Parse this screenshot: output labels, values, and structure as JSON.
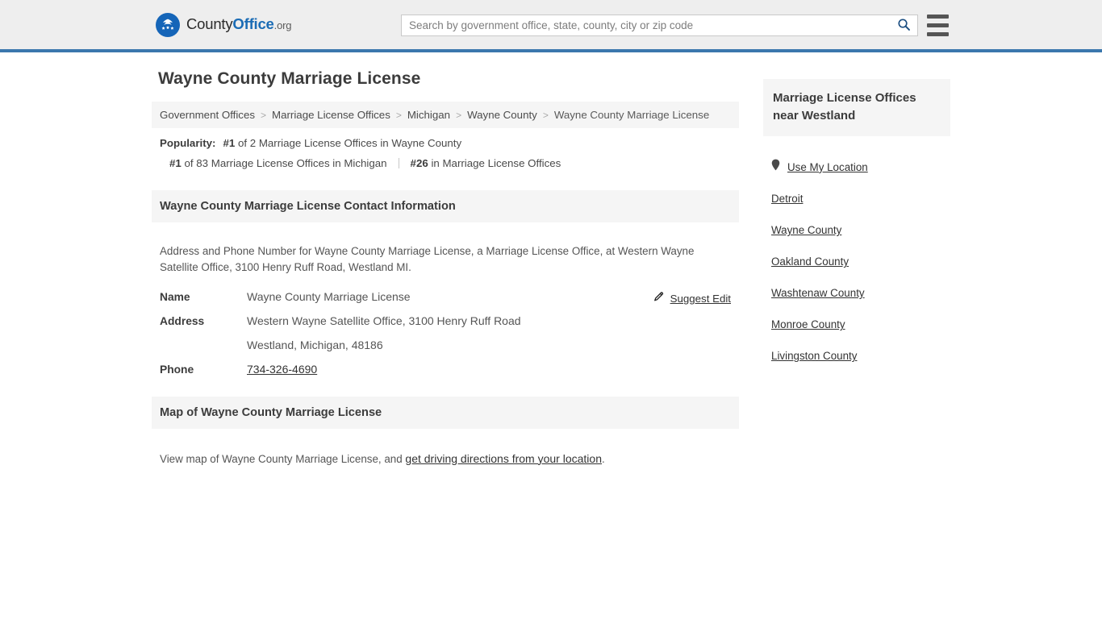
{
  "header": {
    "brand": {
      "logo_icon": "countyoffice-eagle-logo",
      "name_part1": "County",
      "name_part2": "Office",
      "name_part3": ".org"
    },
    "search": {
      "placeholder": "Search by government office, state, county, city or zip code",
      "value": "",
      "icon": "search-icon"
    },
    "menu": {
      "icon": "hamburger-menu-icon",
      "label": "Menu"
    },
    "accent_color": "#3b77ad",
    "background_color": "#eeeeee"
  },
  "page": {
    "title": "Wayne County Marriage License"
  },
  "breadcrumb": {
    "separator": ">",
    "items": [
      {
        "label": "Government Offices",
        "current": false
      },
      {
        "label": "Marriage License Offices",
        "current": false
      },
      {
        "label": "Michigan",
        "current": false
      },
      {
        "label": "Wayne County",
        "current": false
      },
      {
        "label": "Wayne County Marriage License",
        "current": true
      }
    ]
  },
  "popularity": {
    "label": "Popularity:",
    "primary_rank": "#1",
    "primary_text": "of 2 Marriage License Offices in Wayne County",
    "secondary_rank": "#1",
    "secondary_text": "of 83 Marriage License Offices in Michigan",
    "tertiary_rank": "#26",
    "tertiary_text": "in Marriage License Offices"
  },
  "contact_section": {
    "heading": "Wayne County Marriage License Contact Information",
    "description": "Address and Phone Number for Wayne County Marriage License, a Marriage License Office, at Western Wayne Satellite Office, 3100 Henry Ruff Road, Westland MI.",
    "suggest_edit": {
      "label": "Suggest Edit",
      "icon": "edit-pencil-icon"
    },
    "rows": {
      "name_label": "Name",
      "name_value": "Wayne County Marriage License",
      "address_label": "Address",
      "address_line1": "Western Wayne Satellite Office, 3100 Henry Ruff Road",
      "address_line2": "Westland, Michigan, 48186",
      "phone_label": "Phone",
      "phone_value": "734-326-4690"
    }
  },
  "map_section": {
    "heading": "Map of Wayne County Marriage License",
    "text_before": "View map of Wayne County Marriage License, and ",
    "link_label": "get driving directions from your location",
    "text_after": "."
  },
  "sidebar": {
    "heading": "Marriage License Offices near Westland",
    "use_my_location": {
      "label": "Use My Location",
      "icon": "map-pin-icon"
    },
    "links": [
      {
        "label": "Detroit"
      },
      {
        "label": "Wayne County"
      },
      {
        "label": "Oakland County"
      },
      {
        "label": "Washtenaw County"
      },
      {
        "label": "Monroe County"
      },
      {
        "label": "Livingston County"
      }
    ]
  }
}
